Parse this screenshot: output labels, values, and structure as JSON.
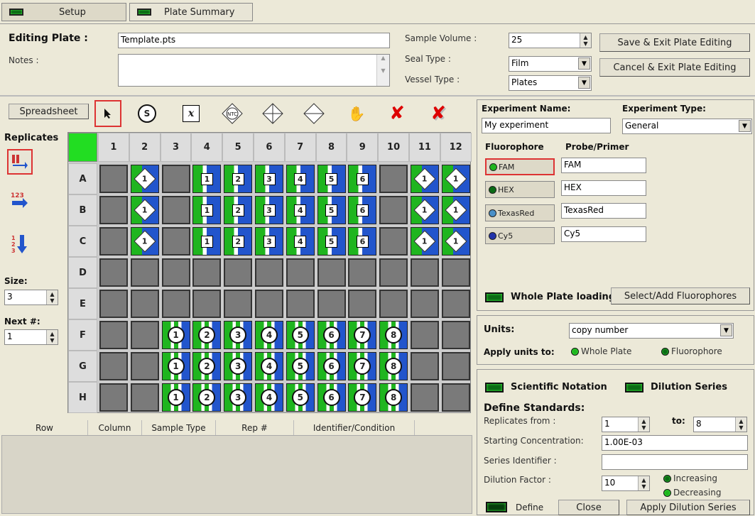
{
  "tabs": {
    "setup": "Setup",
    "plate_summary": "Plate Summary"
  },
  "header": {
    "editing_plate_label": "Editing Plate :",
    "plate_filename": "Template.pts",
    "notes_label": "Notes :",
    "notes_value": "",
    "sample_volume_label": "Sample Volume :",
    "sample_volume_value": "25",
    "seal_type_label": "Seal Type :",
    "seal_type_value": "Film",
    "vessel_type_label": "Vessel Type :",
    "vessel_type_value": "Plates",
    "save_exit": "Save & Exit Plate Editing",
    "cancel_exit": "Cancel & Exit Plate Editing"
  },
  "toolbar": {
    "spreadsheet": "Spreadsheet",
    "tools": [
      "pointer-icon",
      "standard-s-icon",
      "unknown-x-icon",
      "ntc-icon",
      "diamond-cross-icon",
      "diamond-icon",
      "hand-icon",
      "red-x-icon",
      "red-x-clear-icon"
    ],
    "s_label": "S",
    "x_label": "x",
    "ntc_label": "NTC"
  },
  "replicates": {
    "title": "Replicates",
    "size_label": "Size:",
    "size_value": "3",
    "next_label": "Next #:",
    "next_value": "1"
  },
  "plate": {
    "columns": [
      "1",
      "2",
      "3",
      "4",
      "5",
      "6",
      "7",
      "8",
      "9",
      "10",
      "11",
      "12"
    ],
    "rows": [
      "A",
      "B",
      "C",
      "D",
      "E",
      "F",
      "G",
      "H"
    ],
    "wells": [
      [
        "e",
        "d1",
        "e",
        "s1",
        "s2",
        "s3",
        "s4",
        "s5",
        "s6",
        "e",
        "d1",
        "d1"
      ],
      [
        "e",
        "d1",
        "e",
        "s1",
        "s2",
        "s3",
        "s4",
        "s5",
        "s6",
        "e",
        "d1",
        "d1"
      ],
      [
        "e",
        "d1",
        "e",
        "s1",
        "s2",
        "s3",
        "s4",
        "s5",
        "s6",
        "e",
        "d1",
        "d1"
      ],
      [
        "e",
        "e",
        "e",
        "e",
        "e",
        "e",
        "e",
        "e",
        "e",
        "e",
        "e",
        "e"
      ],
      [
        "e",
        "e",
        "e",
        "e",
        "e",
        "e",
        "e",
        "e",
        "e",
        "e",
        "e",
        "e"
      ],
      [
        "e",
        "e",
        "c1",
        "c2",
        "c3",
        "c4",
        "c5",
        "c6",
        "c7",
        "c8",
        "e",
        "e"
      ],
      [
        "e",
        "e",
        "c1",
        "c2",
        "c3",
        "c4",
        "c5",
        "c6",
        "c7",
        "c8",
        "e",
        "e"
      ],
      [
        "e",
        "e",
        "c1",
        "c2",
        "c3",
        "c4",
        "c5",
        "c6",
        "c7",
        "c8",
        "e",
        "e"
      ]
    ]
  },
  "table_headers": [
    "Row",
    "Column",
    "Sample Type",
    "Rep #",
    "Identifier/Condition"
  ],
  "experiment": {
    "name_label": "Experiment Name:",
    "name_value": "My experiment",
    "type_label": "Experiment Type:",
    "type_value": "General",
    "fluorophore_header": "Fluorophore",
    "probe_header": "Probe/Primer",
    "fluorophores": [
      {
        "name": "FAM",
        "probe": "FAM",
        "color": "#1fb51f"
      },
      {
        "name": "HEX",
        "probe": "HEX",
        "color": "#0b6b15"
      },
      {
        "name": "TexasRed",
        "probe": "TexasRed",
        "color": "#4a90c8"
      },
      {
        "name": "Cy5",
        "probe": "Cy5",
        "color": "#2233aa"
      }
    ],
    "whole_plate_loading": "Whole Plate loading",
    "select_add": "Select/Add Fluorophores"
  },
  "units": {
    "label": "Units:",
    "value": "copy number",
    "apply_label": "Apply units to:",
    "opt_whole": "Whole Plate",
    "opt_fluor": "Fluorophore"
  },
  "standards": {
    "sci_notation": "Scientific Notation",
    "dilution_series": "Dilution Series",
    "define_label": "Define Standards:",
    "replicates_from_label": "Replicates from :",
    "replicates_from": "1",
    "to_label": "to:",
    "to_value": "8",
    "start_conc_label": "Starting Concentration:",
    "start_conc": "1.00E-03",
    "series_id_label": "Series Identifier :",
    "series_id": "",
    "dilution_factor_label": "Dilution Factor :",
    "dilution_factor": "10",
    "increasing": "Increasing",
    "decreasing": "Decreasing",
    "define": "Define",
    "close": "Close",
    "apply": "Apply Dilution Series"
  }
}
